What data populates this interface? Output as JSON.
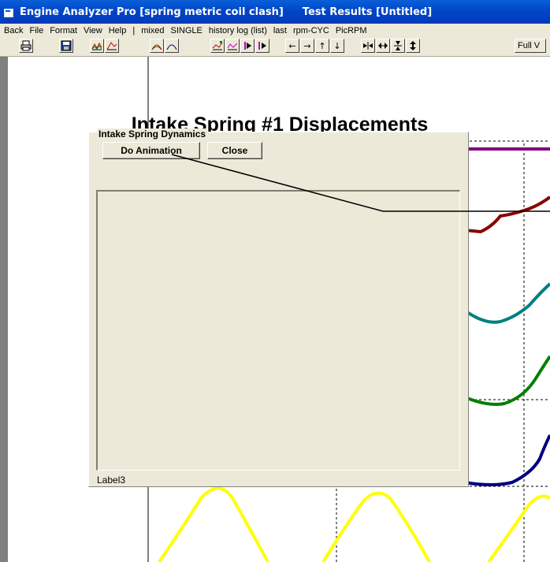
{
  "window": {
    "title_app": "Engine Analyzer Pro [spring metric coil clash]",
    "title_doc": "Test Results [Untitled]"
  },
  "menu": [
    "Back",
    "File",
    "Format",
    "View",
    "Help",
    "|",
    "mixed",
    "SINGLE",
    "history log (list)",
    "last",
    "rpm-CYC",
    "PicRPM"
  ],
  "toolbar": {
    "icons": [
      "printer-icon",
      "save-icon",
      "graph-1-icon",
      "graph-2-icon",
      "graph-3-icon",
      "graph-4-icon",
      "graph-5-icon",
      "graph-6-icon",
      "step-left-icon",
      "step-right-icon",
      "arrow-left-icon",
      "arrow-right-icon",
      "arrow-up-icon",
      "arrow-down-icon",
      "compress-horizontal-icon",
      "expand-horizontal-icon",
      "compress-vertical-icon",
      "expand-vertical-icon"
    ],
    "full_label": "Full V"
  },
  "chart": {
    "title": "Intake Spring #1 Displacements",
    "series_colors": [
      "#800080",
      "#8b0000",
      "#008080",
      "#008000",
      "#000080",
      "#ffff00"
    ]
  },
  "dialog": {
    "title": "Intake Spring Dynamics",
    "animate_label": "Do Animation",
    "close_label": "Close",
    "status_label": "Label3"
  }
}
